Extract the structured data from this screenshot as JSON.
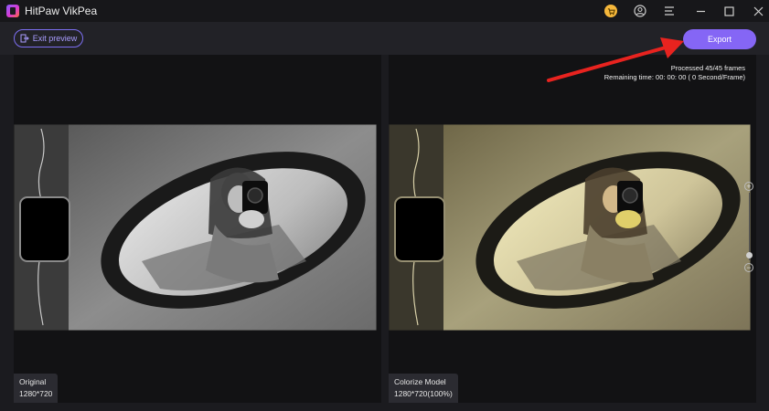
{
  "app": {
    "title": "HitPaw VikPea"
  },
  "toolbar": {
    "exit_label": "Exit preview",
    "export_label": "Export"
  },
  "status": {
    "processed": "Processed 45/45 frames",
    "remaining": "Remaining time: 00: 00: 00 ( 0 Second/Frame)"
  },
  "left_panel": {
    "name": "Original",
    "resolution": "1280*720"
  },
  "right_panel": {
    "name": "Colorize Model",
    "resolution": "1280*720(100%)"
  },
  "icons": [
    "app-logo-icon",
    "cart-icon",
    "user-icon",
    "menu-icon",
    "minimize-icon",
    "maximize-icon",
    "close-icon",
    "exit-icon",
    "zoom-in-icon",
    "zoom-out-icon"
  ],
  "colors": {
    "accent": "#8566f5",
    "cart": "#f5b73b",
    "annotation_arrow": "#e8231f"
  }
}
